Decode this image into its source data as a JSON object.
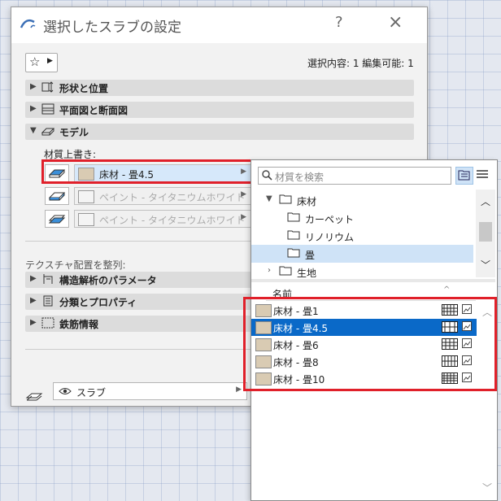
{
  "dialog": {
    "title": "選択したスラブの設定",
    "help_label": "?",
    "close_label": "×",
    "selection_info": "選択内容: 1 編集可能: 1",
    "sections": [
      {
        "label": "形状と位置",
        "expanded": false,
        "icon": "geometry-icon"
      },
      {
        "label": "平面図と断面図",
        "expanded": false,
        "icon": "floorplan-icon"
      },
      {
        "label": "モデル",
        "expanded": true,
        "icon": "model-icon"
      }
    ],
    "override_label": "材質上書き:",
    "materials": [
      {
        "label": "床材 - 畳4.5",
        "enabled": true,
        "swatch": "#d9cbb3"
      },
      {
        "label": "ペイント - タイタニウムホワイト",
        "enabled": false,
        "swatch": "#f4f4f4"
      },
      {
        "label": "ペイント - タイタニウムホワイト",
        "enabled": false,
        "swatch": "#f4f4f4"
      }
    ],
    "texture_label": "テクスチャ配置を整列:",
    "lower_sections": [
      {
        "label": "構造解析のパラメータ",
        "icon": "structure-icon"
      },
      {
        "label": "分類とプロパティ",
        "icon": "classification-icon"
      },
      {
        "label": "鉄筋情報",
        "icon": "rebar-icon"
      }
    ],
    "view_select": "スラブ"
  },
  "popup": {
    "search_placeholder": "材質を検索",
    "tree": [
      {
        "label": "床材",
        "level": 0,
        "expanded": true,
        "selected": false
      },
      {
        "label": "カーペット",
        "level": 1,
        "selected": false
      },
      {
        "label": "リノリウム",
        "level": 1,
        "selected": false
      },
      {
        "label": "畳",
        "level": 1,
        "selected": true
      },
      {
        "label": "生地",
        "level": 0,
        "expanded": false,
        "selected": false
      }
    ],
    "column_header": "名前",
    "items": [
      {
        "label": "床材 - 畳1",
        "selected": false
      },
      {
        "label": "床材 - 畳4.5",
        "selected": true
      },
      {
        "label": "床材 - 畳6",
        "selected": false
      },
      {
        "label": "床材 - 畳8",
        "selected": false
      },
      {
        "label": "床材 - 畳10",
        "selected": false
      }
    ]
  },
  "colors": {
    "highlight": "#e0202a",
    "selection": "#0a69c8",
    "tatami_swatch": "#d9cbb3"
  }
}
